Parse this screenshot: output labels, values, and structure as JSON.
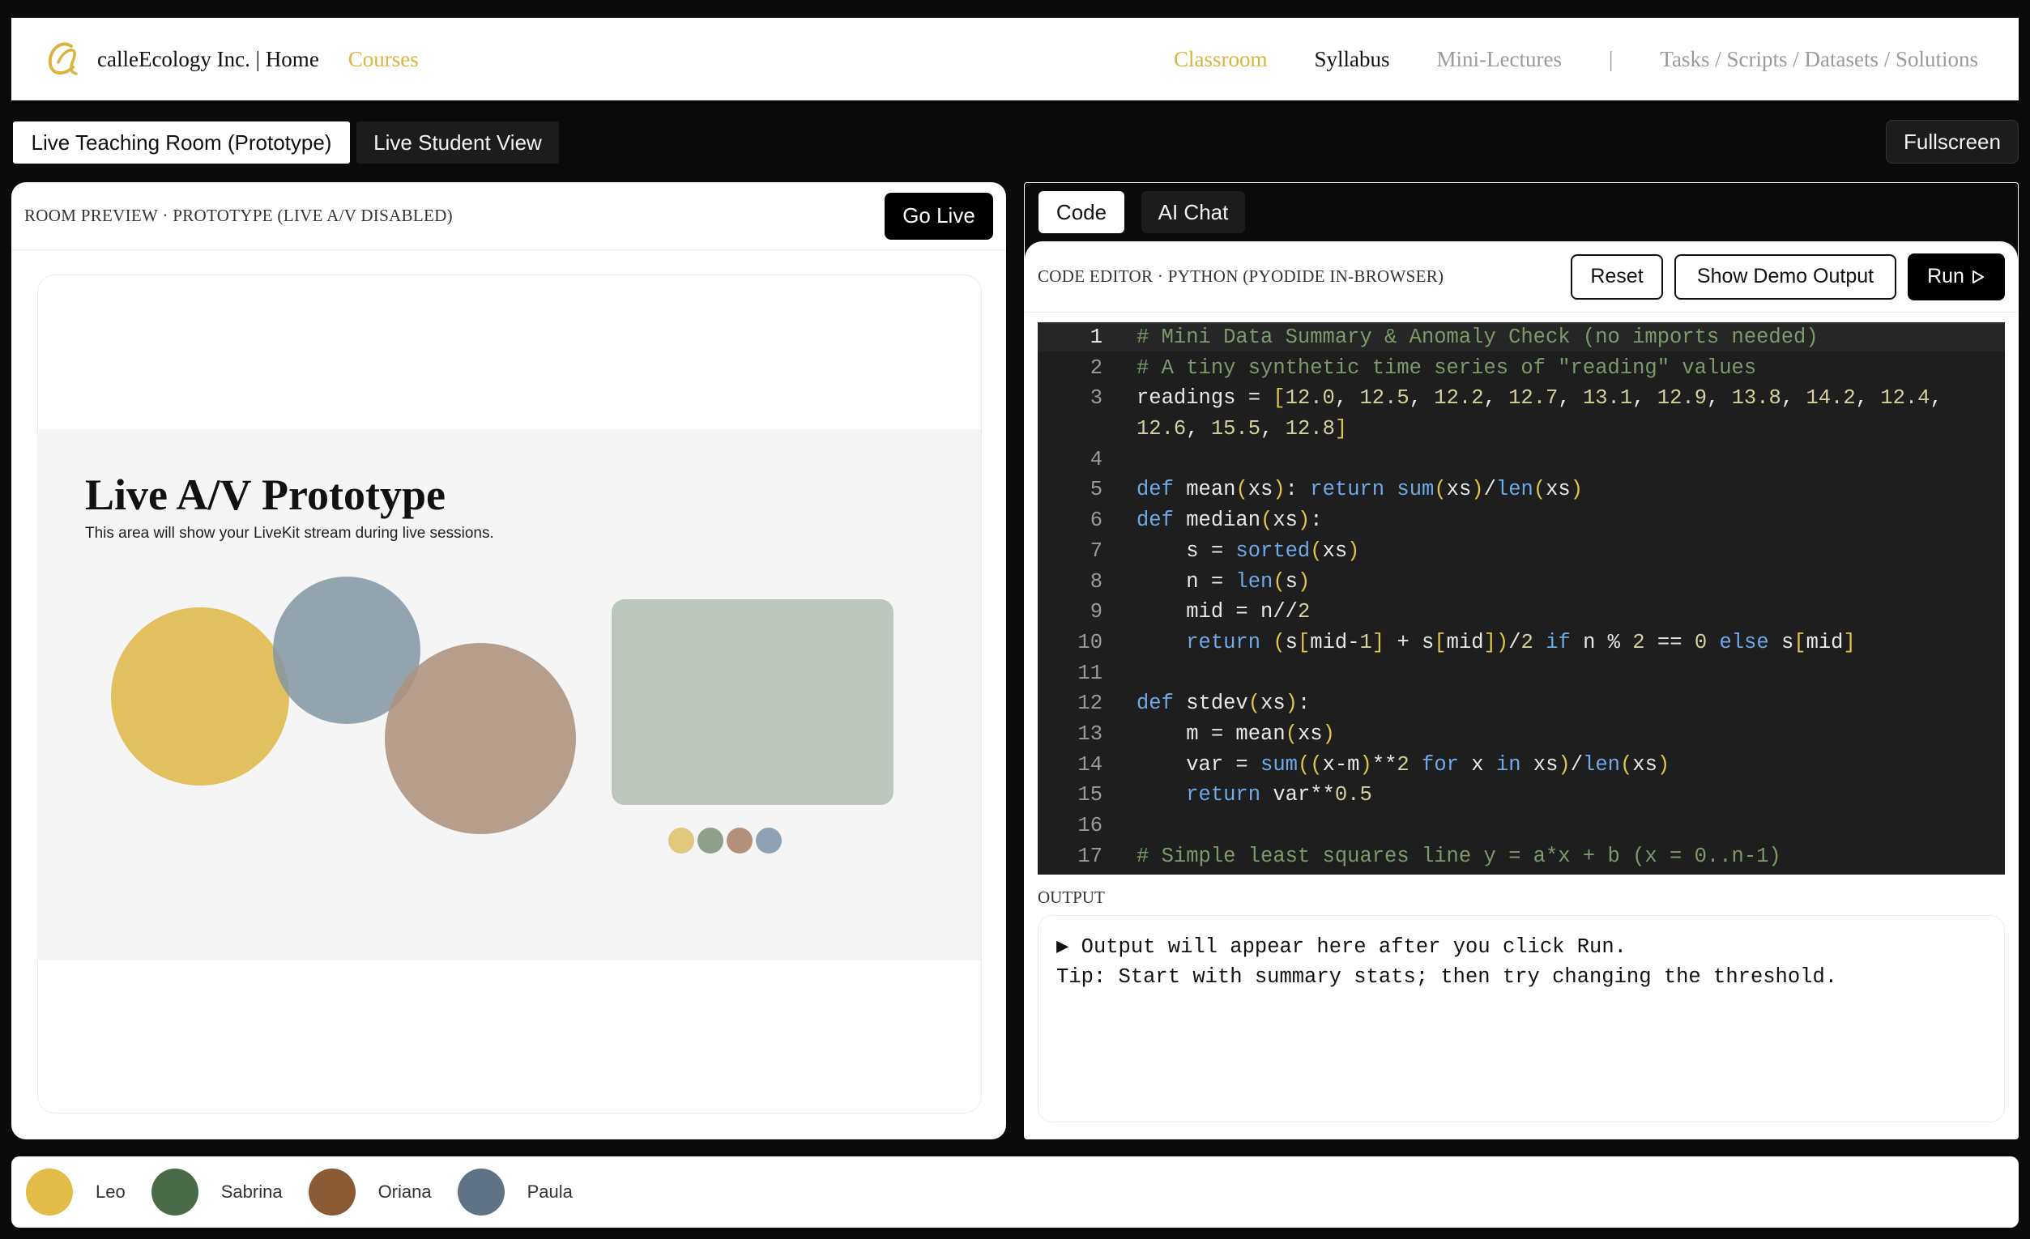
{
  "nav": {
    "brand": "calleEcology Inc. | Home",
    "courses": "Courses",
    "classroom": "Classroom",
    "syllabus": "Syllabus",
    "mini_lectures": "Mini-Lectures",
    "separator": "|",
    "tasks": "Tasks / Scripts / Datasets / Solutions",
    "logo_icon": "script-c-logo-icon",
    "accent_color": "#d9b441"
  },
  "room_tabs": {
    "teaching": "Live Teaching Room (Prototype)",
    "student": "Live Student View",
    "fullscreen": "Fullscreen"
  },
  "room": {
    "label": "ROOM PREVIEW · PROTOTYPE (LIVE A/V DISABLED)",
    "go_live": "Go Live",
    "stage_title": "Live A/V Prototype",
    "stage_subtitle": "This area will show your LiveKit stream during live sessions."
  },
  "editor_tabs": {
    "code": "Code",
    "ai_chat": "AI Chat"
  },
  "editor": {
    "label": "CODE EDITOR · PYTHON (PYODIDE IN-BROWSER)",
    "reset": "Reset",
    "show_demo": "Show Demo Output",
    "run": "Run",
    "run_icon": "play-outline-icon",
    "line_numbers": [
      "1",
      "2",
      "3",
      "",
      "4",
      "5",
      "6",
      "7",
      "8",
      "9",
      "10",
      "11",
      "12",
      "13",
      "14",
      "15",
      "16",
      "17"
    ],
    "code_lines": [
      "# Mini Data Summary & Anomaly Check (no imports needed)",
      "# A tiny synthetic time series of \"reading\" values",
      "readings = [12.0, 12.5, 12.2, 12.7, 13.1, 12.9, 13.8, 14.2, 12.4,",
      "12.6, 15.5, 12.8]",
      "",
      "def mean(xs): return sum(xs)/len(xs)",
      "def median(xs):",
      "    s = sorted(xs)",
      "    n = len(s)",
      "    mid = n//2",
      "    return (s[mid-1] + s[mid])/2 if n % 2 == 0 else s[mid]",
      "",
      "def stdev(xs):",
      "    m = mean(xs)",
      "    var = sum((x-m)**2 for x in xs)/len(xs)",
      "    return var**0.5",
      "",
      "# Simple least squares line y = a*x + b (x = 0..n-1)"
    ]
  },
  "output": {
    "label": "OUTPUT",
    "line1": "▶ Output will appear here after you click Run.",
    "line2": "Tip: Start with summary stats; then try changing the threshold."
  },
  "participants": [
    {
      "name": "Leo",
      "color": "#e2bc48"
    },
    {
      "name": "Sabrina",
      "color": "#4a6b4a"
    },
    {
      "name": "Oriana",
      "color": "#8a5a35"
    },
    {
      "name": "Paula",
      "color": "#5f7385"
    }
  ]
}
